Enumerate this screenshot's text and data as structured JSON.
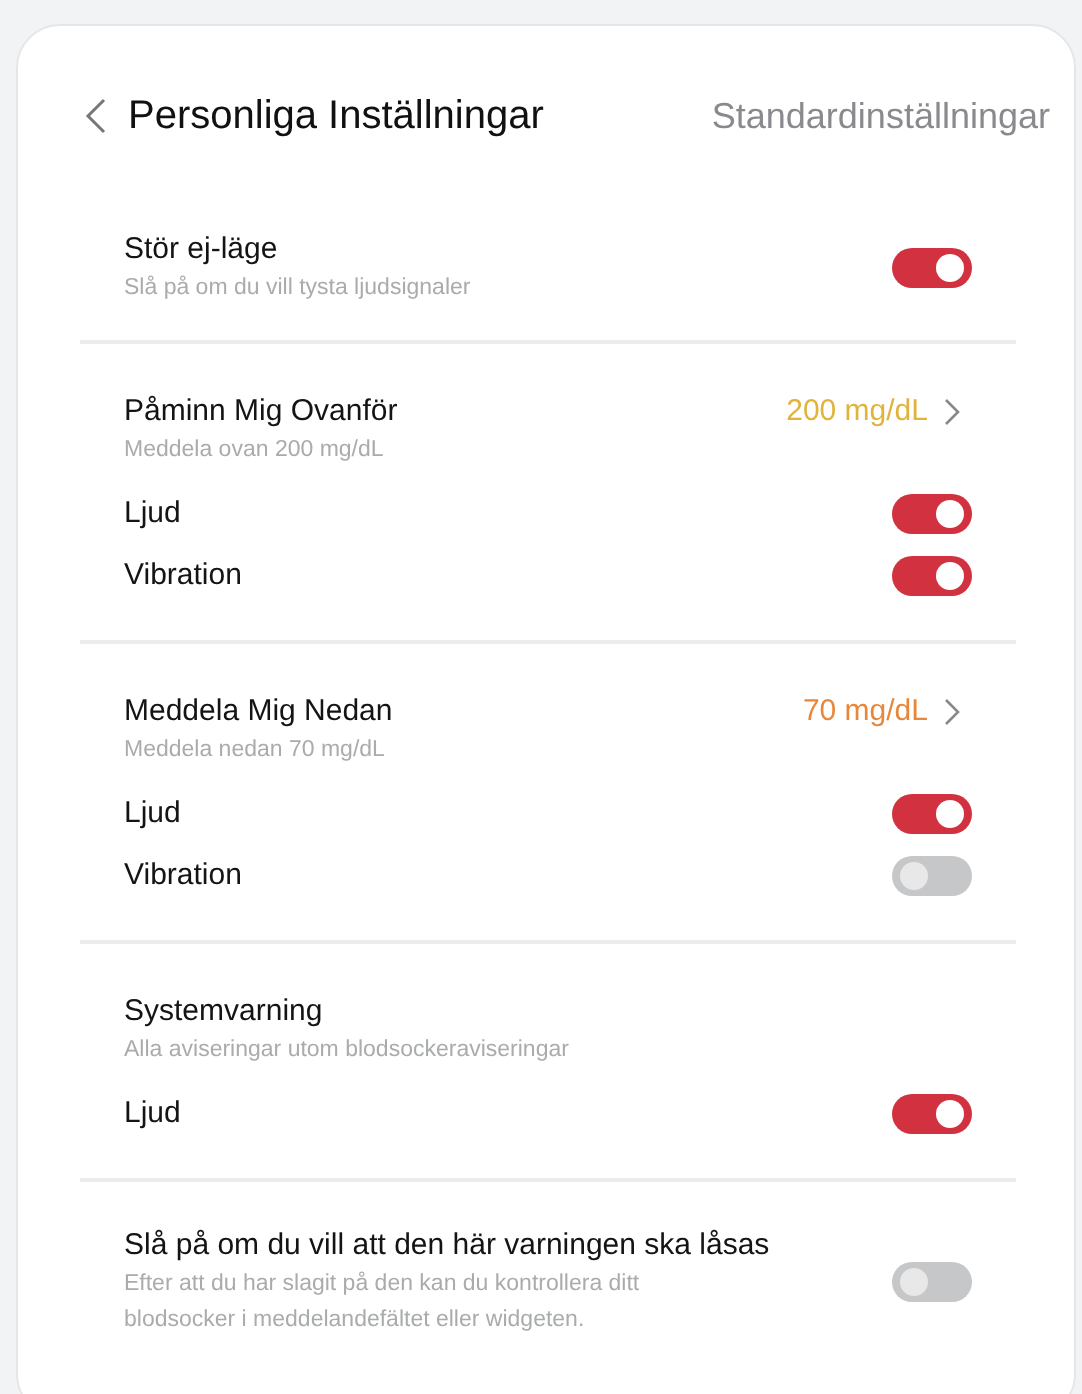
{
  "header": {
    "title": "Personliga Inställningar",
    "action": "Standardinställningar"
  },
  "sections": [
    {
      "title": "Stör ej-läge",
      "subtitle": "Slå på om du vill tysta ljudsignaler",
      "toggle": {
        "on": true
      }
    },
    {
      "title": "Påminn Mig Ovanför",
      "subtitle": "Meddela ovan 200 mg/dL",
      "value": {
        "text": "200 mg/dL",
        "color": "#e2b33c"
      },
      "rows": [
        {
          "label": "Ljud",
          "on": true
        },
        {
          "label": "Vibration",
          "on": true
        }
      ]
    },
    {
      "title": "Meddela Mig Nedan",
      "subtitle": "Meddela nedan 70 mg/dL",
      "value": {
        "text": "70 mg/dL",
        "color": "#e8873a"
      },
      "rows": [
        {
          "label": "Ljud",
          "on": true
        },
        {
          "label": "Vibration",
          "on": false
        }
      ]
    },
    {
      "title": "Systemvarning",
      "subtitle": "Alla aviseringar utom blodsockeraviseringar",
      "rows": [
        {
          "label": "Ljud",
          "on": true
        }
      ]
    },
    {
      "title": "Slå på om du vill att den här varningen ska låsas",
      "subtitle": "Efter att du har slagit på den kan du kontrollera ditt blodsocker i meddelandefältet eller widgeten.",
      "toggle": {
        "on": false
      }
    }
  ]
}
